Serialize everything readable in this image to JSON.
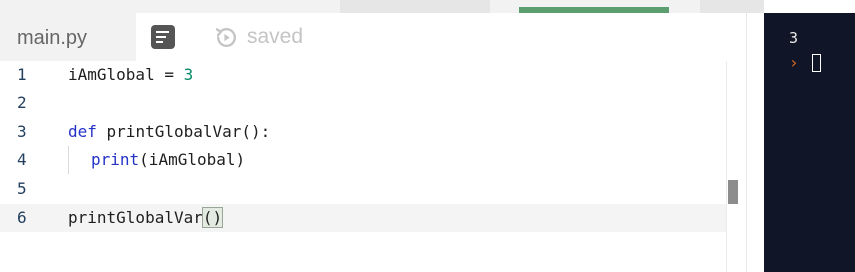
{
  "tab": {
    "filename": "main.py"
  },
  "toolbar": {
    "format_icon": "format-icon",
    "saved_icon": "history-icon",
    "saved_label": "saved"
  },
  "editor": {
    "lines": [
      {
        "number": "1",
        "parts": {
          "a": "iAmGlobal = ",
          "b": "3"
        }
      },
      {
        "number": "2"
      },
      {
        "number": "3",
        "parts": {
          "kw": "def",
          "rest": " printGlobalVar():"
        }
      },
      {
        "number": "4",
        "parts": {
          "kw": "print",
          "rest": "(iAmGlobal)"
        }
      },
      {
        "number": "5"
      },
      {
        "number": "6",
        "parts": {
          "a": "printGlobalVar",
          "brace": "()"
        }
      }
    ]
  },
  "console": {
    "output": "3",
    "prompt": "›"
  },
  "colors": {
    "keyword": "#2532c8",
    "number": "#0b8a6b",
    "console_bg": "#101527",
    "prompt": "#e06a1b",
    "progress": "#5b9e6f"
  }
}
